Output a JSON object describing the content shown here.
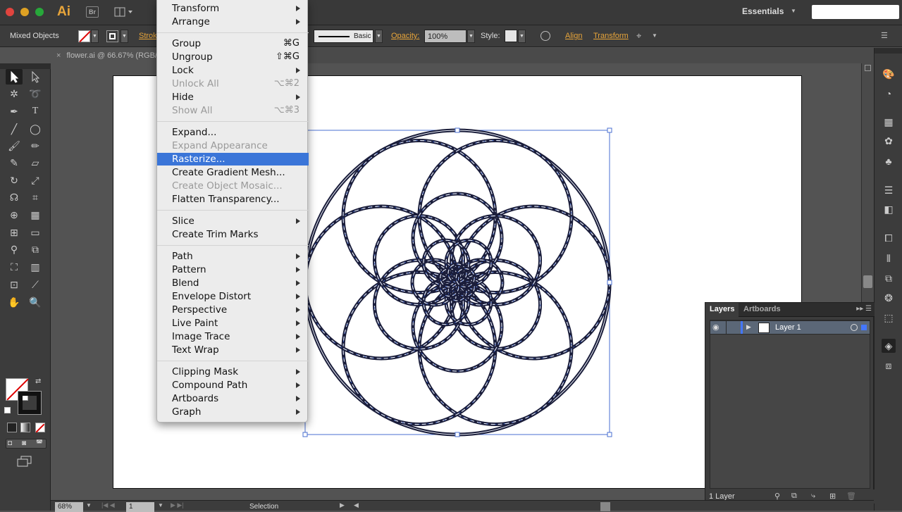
{
  "app": {
    "logo": "Ai",
    "bridge_label": "Br",
    "workspace": "Essentials",
    "search_value": ""
  },
  "control_bar": {
    "selection_type": "Mixed Objects",
    "stroke_label": "Stroke",
    "stroke_profile": "Basic",
    "opacity_label": "Opacity:",
    "opacity_value": "100%",
    "style_label": "Style:",
    "align_label": "Align",
    "transform_label": "Transform"
  },
  "document": {
    "tab_title": "flower.ai @ 66.67% (RGB/",
    "close_glyph": "×"
  },
  "object_menu": {
    "items": [
      {
        "label": "Transform",
        "shortcut": "",
        "submenu": true,
        "disabled": false
      },
      {
        "label": "Arrange",
        "shortcut": "",
        "submenu": true,
        "disabled": false
      },
      {
        "label": "Group",
        "shortcut": "⌘G",
        "submenu": false,
        "disabled": false
      },
      {
        "label": "Ungroup",
        "shortcut": "⇧⌘G",
        "submenu": false,
        "disabled": false
      },
      {
        "label": "Lock",
        "shortcut": "",
        "submenu": true,
        "disabled": false
      },
      {
        "label": "Unlock All",
        "shortcut": "⌥⌘2",
        "submenu": false,
        "disabled": true
      },
      {
        "label": "Hide",
        "shortcut": "",
        "submenu": true,
        "disabled": false
      },
      {
        "label": "Show All",
        "shortcut": "⌥⌘3",
        "submenu": false,
        "disabled": true
      },
      {
        "label": "Expand...",
        "shortcut": "",
        "submenu": false,
        "disabled": false
      },
      {
        "label": "Expand Appearance",
        "shortcut": "",
        "submenu": false,
        "disabled": true
      },
      {
        "label": "Rasterize...",
        "shortcut": "",
        "submenu": false,
        "disabled": false,
        "highlighted": true
      },
      {
        "label": "Create Gradient Mesh...",
        "shortcut": "",
        "submenu": false,
        "disabled": false
      },
      {
        "label": "Create Object Mosaic...",
        "shortcut": "",
        "submenu": false,
        "disabled": true
      },
      {
        "label": "Flatten Transparency...",
        "shortcut": "",
        "submenu": false,
        "disabled": false
      },
      {
        "label": "Slice",
        "shortcut": "",
        "submenu": true,
        "disabled": false
      },
      {
        "label": "Create Trim Marks",
        "shortcut": "",
        "submenu": false,
        "disabled": false
      },
      {
        "label": "Path",
        "shortcut": "",
        "submenu": true,
        "disabled": false
      },
      {
        "label": "Pattern",
        "shortcut": "",
        "submenu": true,
        "disabled": false
      },
      {
        "label": "Blend",
        "shortcut": "",
        "submenu": true,
        "disabled": false
      },
      {
        "label": "Envelope Distort",
        "shortcut": "",
        "submenu": true,
        "disabled": false
      },
      {
        "label": "Perspective",
        "shortcut": "",
        "submenu": true,
        "disabled": false
      },
      {
        "label": "Live Paint",
        "shortcut": "",
        "submenu": true,
        "disabled": false
      },
      {
        "label": "Image Trace",
        "shortcut": "",
        "submenu": true,
        "disabled": false
      },
      {
        "label": "Text Wrap",
        "shortcut": "",
        "submenu": true,
        "disabled": false
      },
      {
        "label": "Clipping Mask",
        "shortcut": "",
        "submenu": true,
        "disabled": false
      },
      {
        "label": "Compound Path",
        "shortcut": "",
        "submenu": true,
        "disabled": false
      },
      {
        "label": "Artboards",
        "shortcut": "",
        "submenu": true,
        "disabled": false
      },
      {
        "label": "Graph",
        "shortcut": "",
        "submenu": true,
        "disabled": false
      }
    ]
  },
  "layers_panel": {
    "tabs": [
      "Layers",
      "Artboards"
    ],
    "layer_name": "Layer 1",
    "footer_count": "1 Layer"
  },
  "status_bar": {
    "zoom": "68%",
    "artboard_number": "1",
    "status": "Selection"
  },
  "colors": {
    "accent": "#3a75d8",
    "selection": "#4477ff",
    "link": "#e8a53a"
  }
}
